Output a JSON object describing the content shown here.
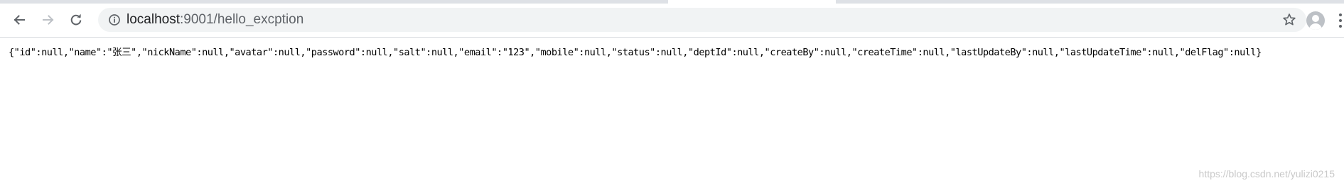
{
  "browser": {
    "url": {
      "host": "localhost",
      "port": ":9001",
      "path": "/hello_excption"
    },
    "icons": {
      "back": "back-arrow-icon",
      "forward": "forward-arrow-icon",
      "reload": "reload-icon",
      "site_info": "info-icon",
      "bookmark": "star-icon",
      "profile": "profile-avatar-icon",
      "menu": "menu-dots-icon"
    }
  },
  "page": {
    "json_text": "{\"id\":null,\"name\":\"张三\",\"nickName\":null,\"avatar\":null,\"password\":null,\"salt\":null,\"email\":\"123\",\"mobile\":null,\"status\":null,\"deptId\":null,\"createBy\":null,\"createTime\":null,\"lastUpdateBy\":null,\"lastUpdateTime\":null,\"delFlag\":null}"
  },
  "watermark": "https://blog.csdn.net/yulizi0215",
  "colors": {
    "tab_strip": "#dee1e6",
    "omnibox": "#f1f3f4",
    "icon": "#5f6368",
    "disabled_icon": "#bdc1c6",
    "watermark": "#c9c9c9"
  }
}
